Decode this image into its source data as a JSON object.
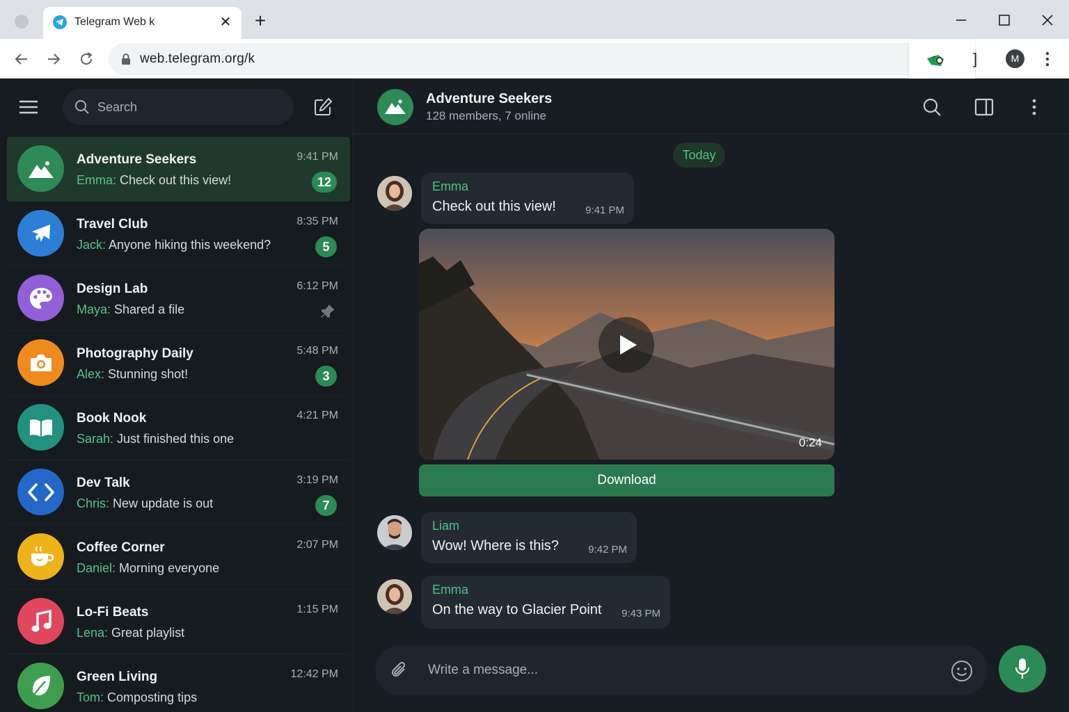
{
  "browser": {
    "tab_title": "Telegram Web k",
    "url": "web.telegram.org/k",
    "profile_initial": "M",
    "extension_bracket": "]"
  },
  "sidebar": {
    "search_placeholder": "Search",
    "chats": [
      {
        "name": "Adventure Seekers",
        "sender": "Emma:",
        "text": " Check out this view!",
        "time": "9:41 PM",
        "badge": "12",
        "icon": "mountain-icon",
        "color": "#2e8a57",
        "active": true
      },
      {
        "name": "Travel Club",
        "sender": "Jack:",
        "text": " Anyone hiking this weekend?",
        "time": "8:35 PM",
        "badge": "5",
        "icon": "airplane-icon",
        "color": "#2d7fd6"
      },
      {
        "name": "Design Lab",
        "sender": "Maya:",
        "text": " Shared a file",
        "time": "6:12 PM",
        "badge": "",
        "pinned": true,
        "icon": "palette-icon",
        "color": "#9160d8"
      },
      {
        "name": "Photography Daily",
        "sender": "Alex:",
        "text": " Stunning shot!",
        "time": "5:48 PM",
        "badge": "3",
        "icon": "camera-icon",
        "color": "#ef8a1f"
      },
      {
        "name": "Book Nook",
        "sender": "Sarah:",
        "text": " Just finished this one",
        "time": "4:21 PM",
        "badge": "",
        "icon": "book-icon",
        "color": "#23917f"
      },
      {
        "name": "Dev Talk",
        "sender": "Chris:",
        "text": " New update is out",
        "time": "3:19 PM",
        "badge": "7",
        "icon": "code-icon",
        "color": "#2368c9"
      },
      {
        "name": "Coffee Corner",
        "sender": "Daniel:",
        "text": " Morning everyone",
        "time": "2:07 PM",
        "badge": "",
        "icon": "coffee-icon",
        "color": "#f0b21a"
      },
      {
        "name": "Lo-Fi Beats",
        "sender": "Lena:",
        "text": " Great playlist",
        "time": "1:15 PM",
        "badge": "",
        "icon": "music-note-icon",
        "color": "#e0475d"
      },
      {
        "name": "Green Living",
        "sender": "Tom:",
        "text": " Composting tips",
        "time": "12:42 PM",
        "badge": "",
        "icon": "leaf-icon",
        "color": "#3f9e4d"
      }
    ]
  },
  "chat": {
    "title": "Adventure Seekers",
    "subtitle": "128 members, 7 online",
    "date_chip": "Today",
    "messages": [
      {
        "sender": "Emma",
        "text": "Check out this view!",
        "time": "9:41 PM"
      },
      {
        "sender": "Liam",
        "text": "Wow! Where is this?",
        "time": "9:42 PM"
      },
      {
        "sender": "Emma",
        "text": "On the way to Glacier Point",
        "time": "9:43 PM"
      }
    ],
    "video": {
      "duration": "0:24",
      "download_label": "Download"
    },
    "composer_placeholder": "Write a message..."
  },
  "colors": {
    "accent": "#2b8a55",
    "active_chat": "#1f3a2c",
    "sender_name": "#4fc283"
  }
}
